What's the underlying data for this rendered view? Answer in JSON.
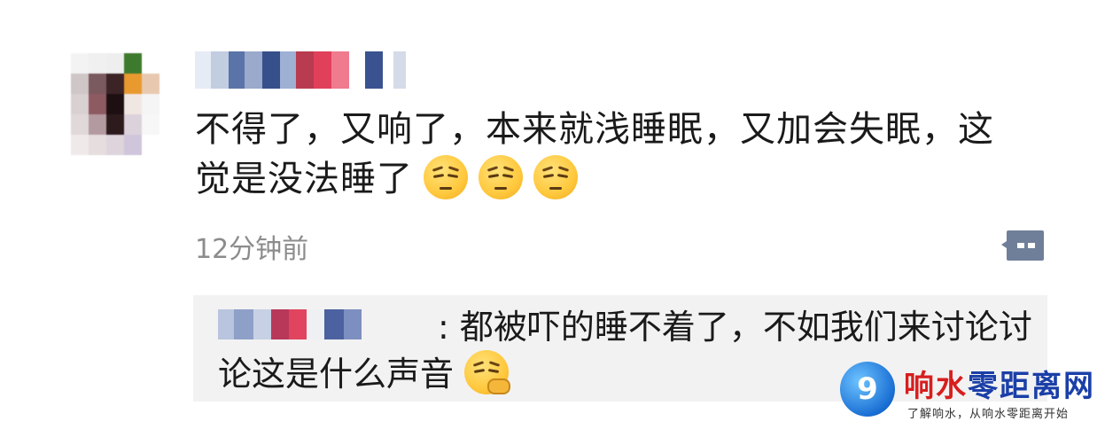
{
  "comment": {
    "text": "不得了，又响了，本来就浅睡眠，又加会失眠，这觉是没法睡了",
    "emojis": [
      "pensive-face",
      "pensive-face",
      "pensive-face"
    ],
    "timestamp": "12分钟前"
  },
  "reply": {
    "separator": ":",
    "text": "都被吓的睡不着了，不如我们来讨论讨论这是什么声音",
    "emoji": "thinking-face"
  },
  "watermark": {
    "logo_glyph": "9",
    "title_part1": "响水",
    "title_part2": "零距离网",
    "subtitle": "了解响水，从响水零距离开始"
  },
  "colors": {
    "background": "#ffffff",
    "reply_background": "#f2f2f2",
    "timestamp": "#8c8c8c",
    "reply_button": "#6f7f99",
    "watermark_red": "#d81e1e",
    "watermark_blue": "#1b3fa8"
  }
}
